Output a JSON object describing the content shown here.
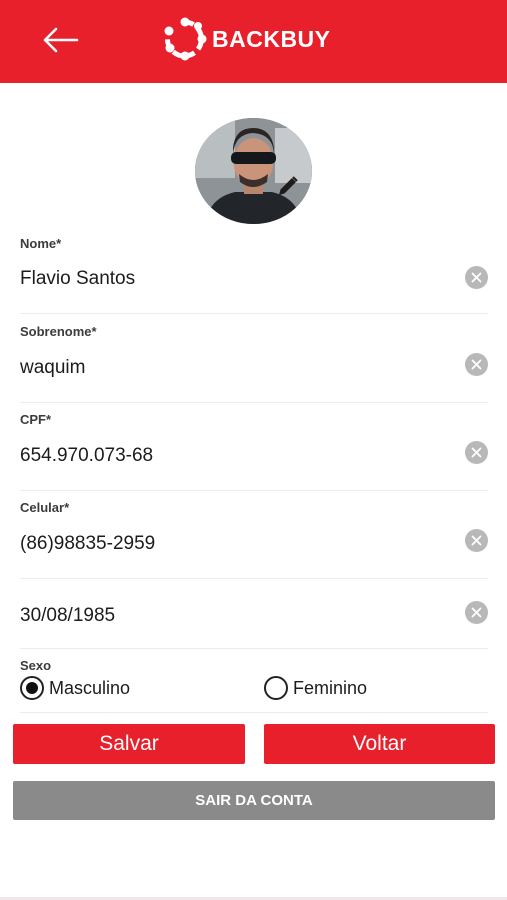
{
  "header": {
    "brand": "BACKBUY",
    "accent_color": "#e8202c",
    "back_icon": "arrow-left-icon"
  },
  "profile": {
    "avatar_icon": "user-photo",
    "edit_icon": "pencil-icon"
  },
  "form": {
    "fields": [
      {
        "label": "Nome*",
        "value": "Flavio Santos"
      },
      {
        "label": "Sobrenome*",
        "value": "waquim"
      },
      {
        "label": "CPF*",
        "value": "654.970.073-68"
      },
      {
        "label": "Celular*",
        "value": "(86)98835-2959"
      },
      {
        "label": "",
        "value": "30/08/1985"
      }
    ],
    "clear_icon": "clear-x-icon"
  },
  "sexo": {
    "label": "Sexo",
    "options": [
      {
        "label": "Masculino",
        "selected": true
      },
      {
        "label": "Feminino",
        "selected": false
      }
    ]
  },
  "actions": {
    "save_label": "Salvar",
    "back_label": "Voltar",
    "logout_label": "SAIR DA CONTA"
  }
}
